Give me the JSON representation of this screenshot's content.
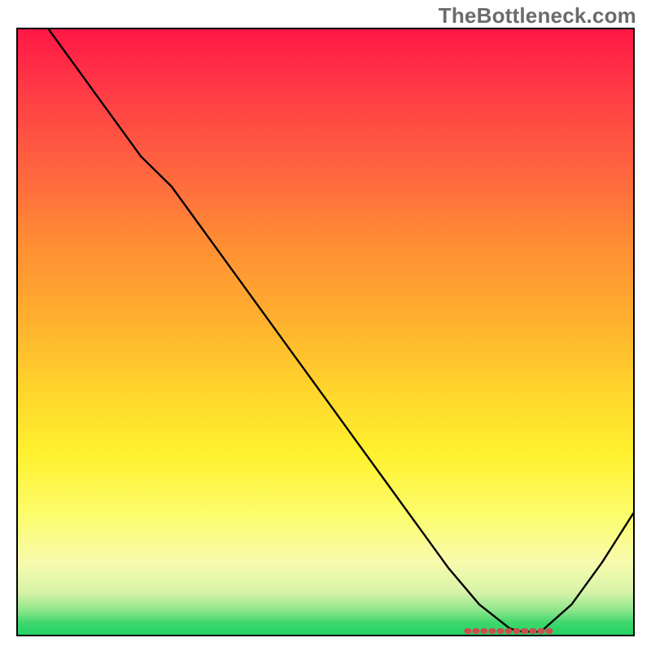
{
  "watermark": "TheBottleneck.com",
  "colors": {
    "curve": "#000000",
    "marker": "#cc4d4d"
  },
  "chart_data": {
    "type": "line",
    "title": "",
    "xlabel": "",
    "ylabel": "",
    "xlim": [
      0,
      100
    ],
    "ylim": [
      0,
      100
    ],
    "grid": false,
    "legend": false,
    "background": "spectral-vertical",
    "series": [
      {
        "name": "bottleneck-curve",
        "x": [
          5,
          10,
          15,
          20,
          25,
          30,
          35,
          40,
          45,
          50,
          55,
          60,
          65,
          70,
          75,
          80,
          82,
          85,
          90,
          95,
          100
        ],
        "y": [
          100,
          93,
          86,
          79,
          74,
          67,
          60,
          53,
          46,
          39,
          32,
          25,
          18,
          11,
          5,
          1,
          0.5,
          0.5,
          5,
          12,
          20
        ]
      }
    ],
    "annotations": [
      {
        "name": "optimum-range",
        "type": "segment",
        "y": 0.6,
        "x_start": 73,
        "x_end": 87,
        "style": "dashed",
        "color": "#cc4d4d"
      }
    ]
  }
}
